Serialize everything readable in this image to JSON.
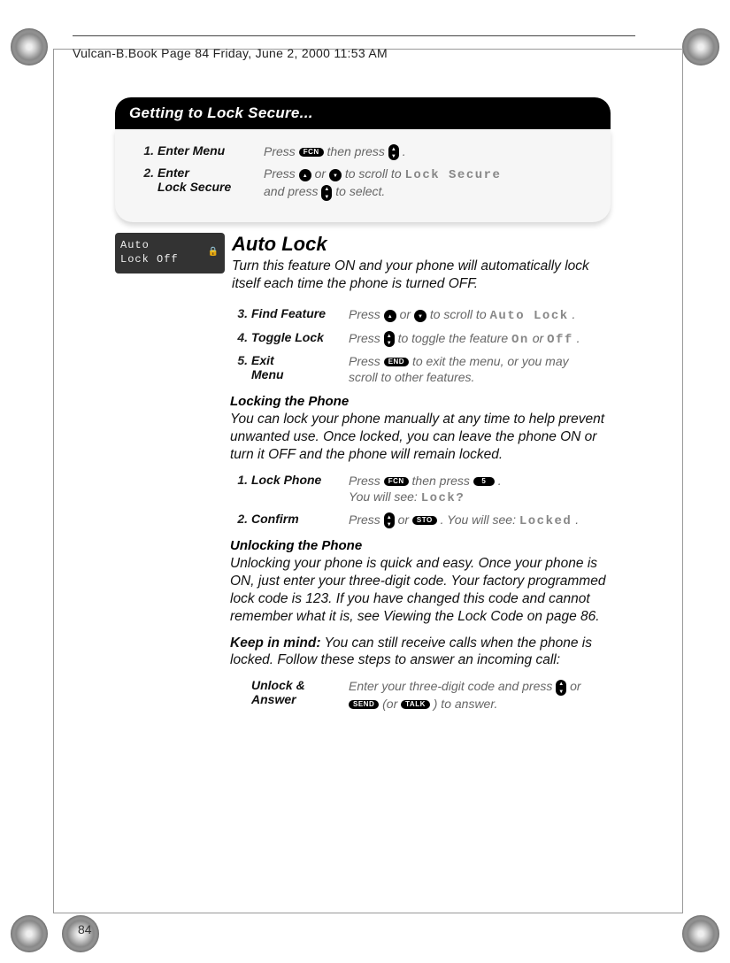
{
  "header": {
    "printline": "Vulcan-B.Book  Page 84  Friday, June 2, 2000  11:53 AM"
  },
  "getting_to": {
    "title": "Getting to Lock Secure...",
    "steps": [
      {
        "num": "1.",
        "label": "Enter Menu",
        "desc_pre": "Press ",
        "btn1": "FCN",
        "desc_mid": " then press ",
        "btn2": "•",
        "desc_post": "."
      },
      {
        "num": "2.",
        "label_l1": "Enter",
        "label_l2": "Lock Secure",
        "desc_l1_pre": "Press ",
        "desc_l1_mid": " or ",
        "desc_l1_post": " to scroll to ",
        "mono1": "Lock  Secure",
        "desc_l2_pre": "and press ",
        "desc_l2_post": " to select."
      }
    ]
  },
  "lcd": {
    "line1": "Auto",
    "line2": "Lock Off"
  },
  "autolock": {
    "title": "Auto Lock",
    "intro": "Turn this feature ON and your phone will automatically lock itself each time the phone is turned OFF.",
    "steps": [
      {
        "num": "3.",
        "label": "Find Feature",
        "pre": "Press ",
        "mid1": " or ",
        "mid2": " to scroll to ",
        "mono": "Auto  Lock",
        "post": "."
      },
      {
        "num": "4.",
        "label": "Toggle Lock",
        "pre": "Press ",
        "mid": " to toggle the feature ",
        "mono1": "On",
        "or": " or ",
        "mono2": "Off",
        "post": "."
      },
      {
        "num": "5.",
        "label_l1": "Exit",
        "label_l2": "Menu",
        "pre": "Press ",
        "btn": "END",
        "mid": " to exit the menu, or you may",
        "l2": "scroll to other features."
      }
    ]
  },
  "locking": {
    "heading": "Locking the Phone",
    "para": "You can lock your phone manually at any time to help prevent unwanted use. Once locked, you can leave the phone ON or turn it OFF and the phone will remain locked.",
    "steps": [
      {
        "num": "1.",
        "label": "Lock Phone",
        "pre": "Press ",
        "btn1": "FCN",
        "mid1": " then press ",
        "btn2": "5",
        "post1": ".",
        "l2_pre": "You will see: ",
        "l2_mono": "Lock?"
      },
      {
        "num": "2.",
        "label": "Confirm",
        "pre": "Press ",
        "mid1": " or ",
        "btn2": "STO",
        "mid2": ". You will see: ",
        "mono": "Locked",
        "post": "."
      }
    ]
  },
  "unlocking": {
    "heading": "Unlocking the Phone",
    "para": "Unlocking your phone is quick and easy. Once your phone is ON, just enter your three-digit code. Your factory programmed lock code is 123. If you have changed this code and cannot remember what it is, see Viewing the Lock Code on page 86.",
    "keep_label": "Keep in mind:",
    "keep_text": " You can still receive calls when the phone is locked. Follow these steps to answer an incoming call:",
    "step": {
      "label_l1": "Unlock &",
      "label_l2": "Answer",
      "pre": "Enter your three-digit code and press ",
      "mid1": " or",
      "l2_btn1": "SEND",
      "l2_mid": " (or ",
      "l2_btn2": "TALK",
      "l2_post": ") to answer."
    }
  },
  "page_number": "84"
}
